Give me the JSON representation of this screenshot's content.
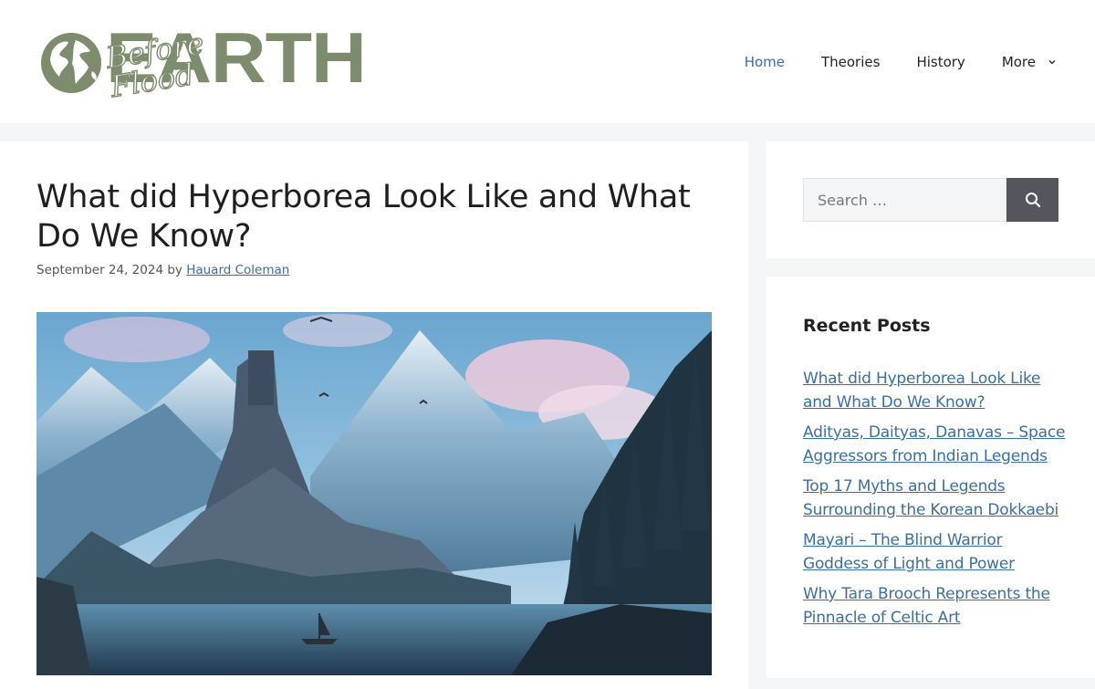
{
  "site": {
    "logo_word": "EARTH",
    "logo_script": "Before Flood"
  },
  "nav": {
    "items": [
      {
        "label": "Home"
      },
      {
        "label": "Theories"
      },
      {
        "label": "History"
      },
      {
        "label": "More"
      }
    ]
  },
  "article": {
    "title": "What did Hyperborea Look Like and What Do We Know?",
    "date": "September 24, 2024",
    "by": "by",
    "author": "Hauard Coleman"
  },
  "sidebar": {
    "search_placeholder": "Search …",
    "recent_title": "Recent Posts",
    "recent_posts": [
      "What did Hyperborea Look Like and What Do We Know?",
      "Adityas, Daityas, Danavas – Space Aggressors from Indian Legends",
      "Top 17 Myths and Legends Surrounding the Korean Dokkaebi",
      "Mayari – The Blind Warrior Goddess of Light and Power",
      "Why Tara Brooch Represents the Pinnacle of Celtic Art"
    ]
  },
  "colors": {
    "accent": "#3b6fa0",
    "logo_green": "#7d8c6c",
    "search_button": "#55555e"
  },
  "icons": {
    "nav_more": "chevron-down-icon",
    "search": "search-icon"
  }
}
